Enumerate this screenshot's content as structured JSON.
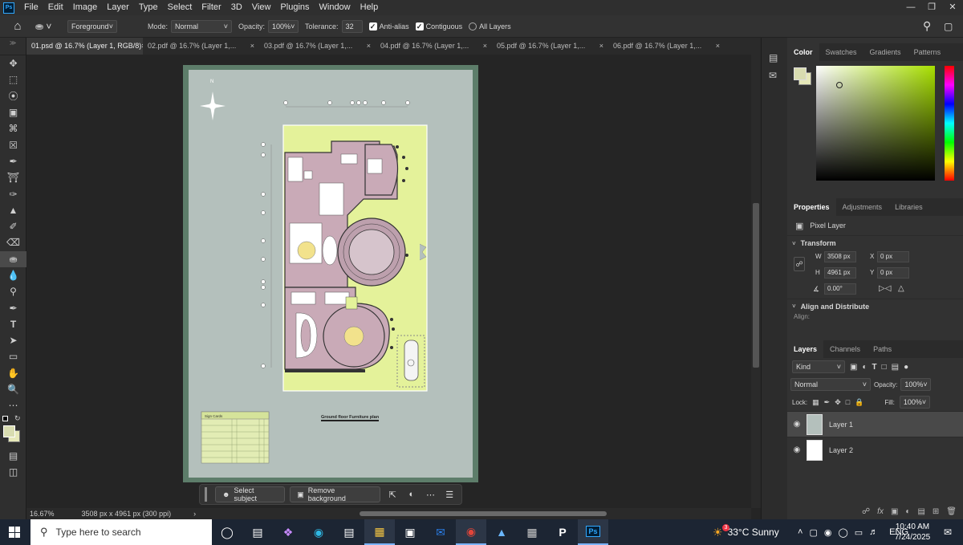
{
  "menu": [
    "File",
    "Edit",
    "Image",
    "Layer",
    "Type",
    "Select",
    "Filter",
    "3D",
    "View",
    "Plugins",
    "Window",
    "Help"
  ],
  "options": {
    "fill_source": "Foreground",
    "mode_label": "Mode:",
    "mode_value": "Normal",
    "opacity_label": "Opacity:",
    "opacity_value": "100%",
    "tolerance_label": "Tolerance:",
    "tolerance_value": "32",
    "antialias": "Anti-alias",
    "contiguous": "Contiguous",
    "all_layers": "All Layers"
  },
  "tabs": [
    "01.psd @ 16.7% (Layer 1, RGB/8)",
    "02.pdf @ 16.7% (Layer 1,...",
    "03.pdf @ 16.7% (Layer 1,...",
    "04.pdf @ 16.7% (Layer 1,...",
    "05.pdf @ 16.7% (Layer 1,...",
    "06.pdf @ 16.7% (Layer 1,..."
  ],
  "document": {
    "north": "N",
    "plan_title": "Ground floor Furniture plan",
    "table_title": "Sign Cards",
    "legend_rows": 8
  },
  "context_bar": {
    "select_subject": "Select subject",
    "remove_background": "Remove background"
  },
  "status": {
    "zoom": "16.67%",
    "doc_info": "3508 px x 4961 px (300 ppi)"
  },
  "panels": {
    "color_tabs": [
      "Color",
      "Swatches",
      "Gradients",
      "Patterns"
    ],
    "foreground_color": "#d8dcb0",
    "properties_tabs": [
      "Properties",
      "Adjustments",
      "Libraries"
    ],
    "pixel_layer": "Pixel Layer",
    "transform_title": "Transform",
    "w_label": "W",
    "w_value": "3508 px",
    "h_label": "H",
    "h_value": "4961 px",
    "x_label": "X",
    "x_value": "0 px",
    "y_label": "Y",
    "y_value": "0 px",
    "angle_value": "0.00°",
    "align_title": "Align and Distribute",
    "align_label": "Align:",
    "layers_tabs": [
      "Layers",
      "Channels",
      "Paths"
    ],
    "kind_label": "Kind",
    "blend_mode": "Normal",
    "opacity_label": "Opacity:",
    "opacity_value": "100%",
    "lock_label": "Lock:",
    "fill_label": "Fill:",
    "fill_value": "100%",
    "layers": [
      "Layer 1",
      "Layer 2"
    ]
  },
  "taskbar": {
    "search_placeholder": "Type here to search",
    "weather": "33°C  Sunny",
    "weather_badge": "3",
    "lang": "ENG",
    "time": "10:40 AM",
    "date": "7/24/2025"
  }
}
